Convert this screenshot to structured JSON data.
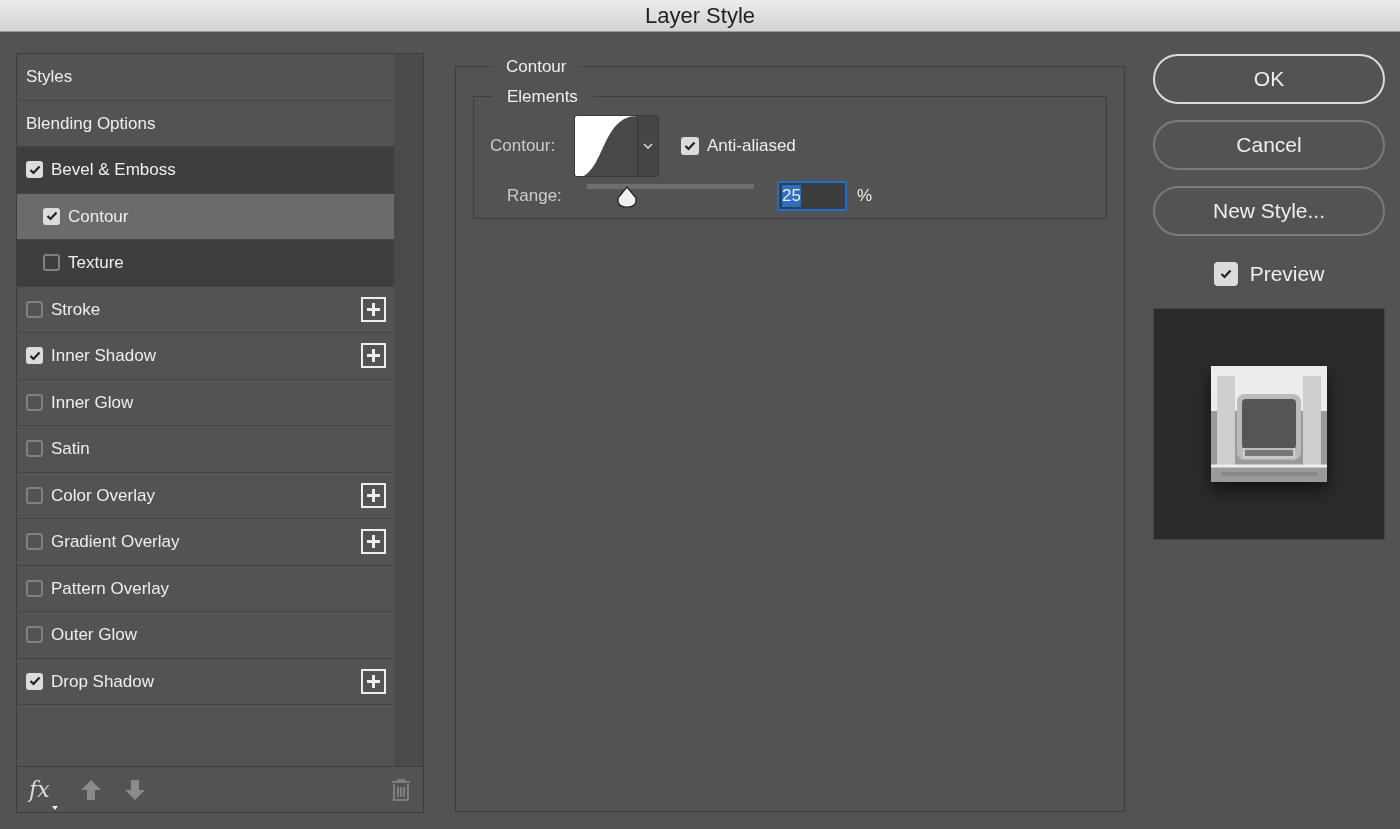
{
  "window": {
    "title": "Layer Style"
  },
  "styles_list": {
    "items": [
      {
        "kind": "header",
        "label": "Styles",
        "selected": false
      },
      {
        "kind": "header",
        "label": "Blending Options",
        "selected": false
      },
      {
        "kind": "effect",
        "label": "Bevel & Emboss",
        "checked": true,
        "selected": false,
        "add_button": false,
        "children": [
          {
            "kind": "effect",
            "label": "Contour",
            "checked": true,
            "selected": true,
            "add_button": false
          },
          {
            "kind": "effect",
            "label": "Texture",
            "checked": false,
            "selected": false,
            "add_button": false
          }
        ]
      },
      {
        "kind": "effect",
        "label": "Stroke",
        "checked": false,
        "selected": false,
        "add_button": true
      },
      {
        "kind": "effect",
        "label": "Inner Shadow",
        "checked": true,
        "selected": false,
        "add_button": true
      },
      {
        "kind": "effect",
        "label": "Inner Glow",
        "checked": false,
        "selected": false,
        "add_button": false
      },
      {
        "kind": "effect",
        "label": "Satin",
        "checked": false,
        "selected": false,
        "add_button": false
      },
      {
        "kind": "effect",
        "label": "Color Overlay",
        "checked": false,
        "selected": false,
        "add_button": true
      },
      {
        "kind": "effect",
        "label": "Gradient Overlay",
        "checked": false,
        "selected": false,
        "add_button": true
      },
      {
        "kind": "effect",
        "label": "Pattern Overlay",
        "checked": false,
        "selected": false,
        "add_button": false
      },
      {
        "kind": "effect",
        "label": "Outer Glow",
        "checked": false,
        "selected": false,
        "add_button": false
      },
      {
        "kind": "effect",
        "label": "Drop Shadow",
        "checked": true,
        "selected": false,
        "add_button": true
      }
    ],
    "toolbar": {
      "fx_label": "fx"
    }
  },
  "contour_panel": {
    "title": "Contour",
    "elements": {
      "title": "Elements",
      "contour_label": "Contour:",
      "anti_aliased": {
        "label": "Anti-aliased",
        "checked": true
      },
      "range": {
        "label": "Range:",
        "level": 0.24,
        "value": "25",
        "unit": "%"
      }
    }
  },
  "buttons": [
    {
      "label": "OK",
      "default": true
    },
    {
      "label": "Cancel",
      "default": false
    },
    {
      "label": "New Style...",
      "default": false
    }
  ],
  "preview": {
    "label": "Preview",
    "checked": true
  }
}
